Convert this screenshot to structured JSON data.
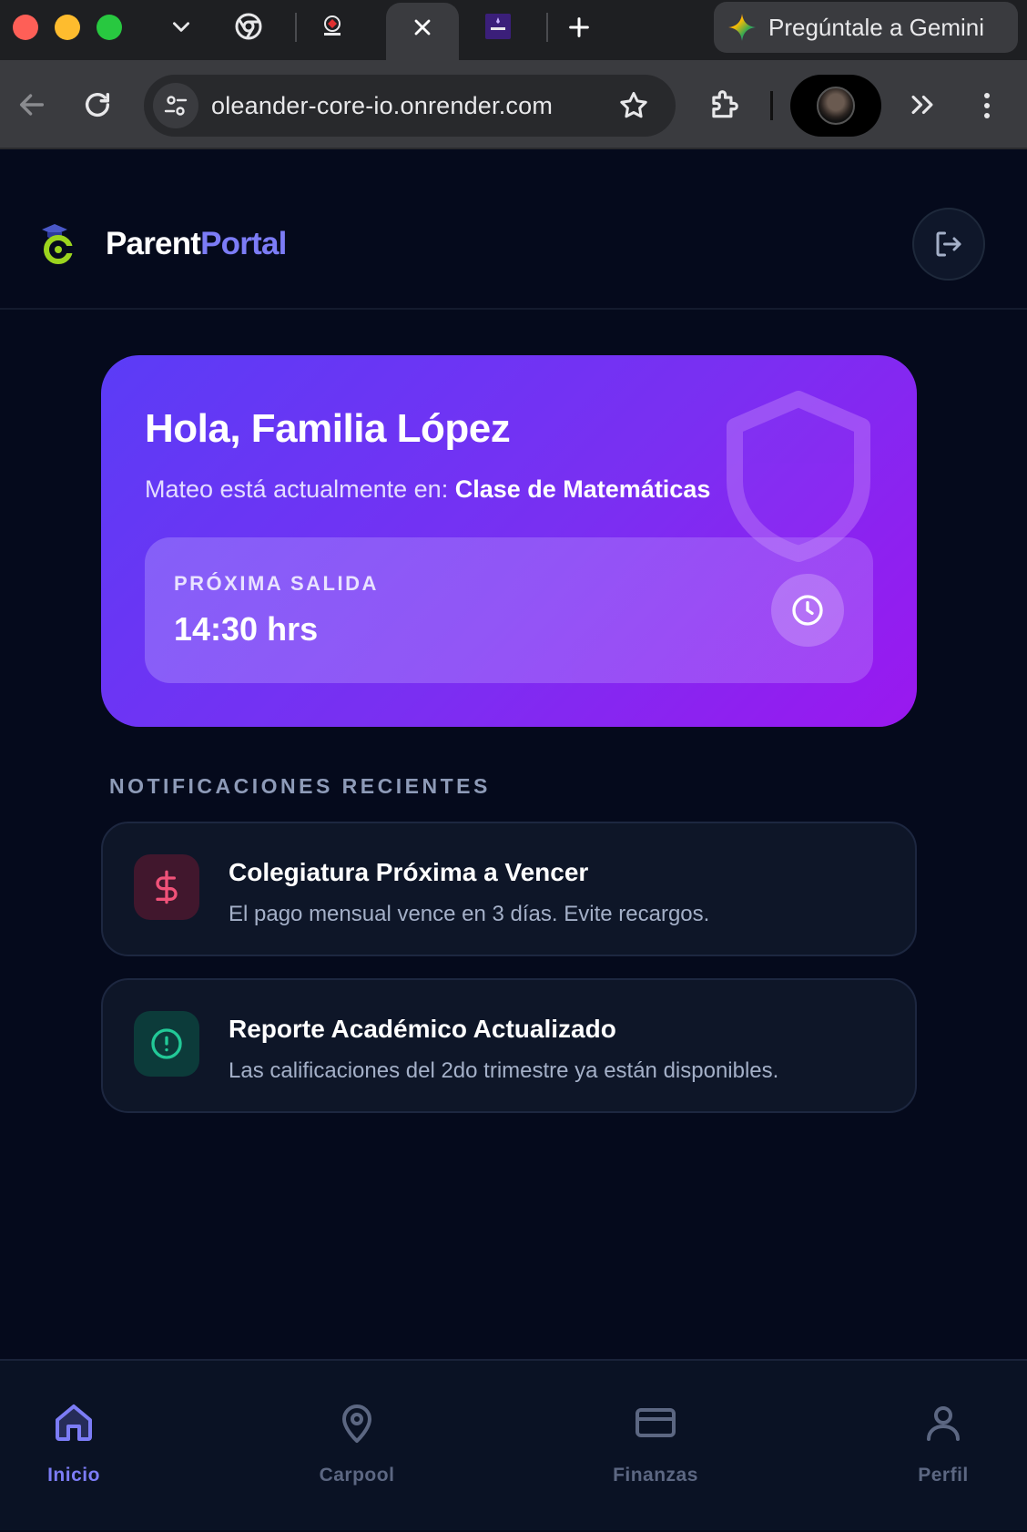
{
  "browser": {
    "gemini_label": "Pregúntale a Gemini",
    "url": "oleander-core-io.onrender.com"
  },
  "app": {
    "brand_part1": "Parent",
    "brand_part2": "Portal"
  },
  "hero": {
    "greeting": "Hola, Familia López",
    "status_prefix": "Mateo está actualmente en: ",
    "status_location": "Clase de Matemáticas",
    "exit_label": "PRÓXIMA SALIDA",
    "exit_time": "14:30 hrs"
  },
  "notifications": {
    "section_title": "NOTIFICACIONES RECIENTES",
    "items": [
      {
        "title": "Colegiatura Próxima a Vencer",
        "body": "El pago mensual vence en 3 días. Evite recargos.",
        "icon": "dollar-icon",
        "color": "#f05279"
      },
      {
        "title": "Reporte Académico Actualizado",
        "body": "Las calificaciones del 2do trimestre ya están disponibles.",
        "icon": "alert-circle-icon",
        "color": "#22c997"
      }
    ]
  },
  "bottom_nav": {
    "items": [
      {
        "label": "Inicio",
        "icon": "home-icon",
        "active": true
      },
      {
        "label": "Carpool",
        "icon": "map-pin-icon",
        "active": false
      },
      {
        "label": "Finanzas",
        "icon": "credit-card-icon",
        "active": false
      },
      {
        "label": "Perfil",
        "icon": "user-icon",
        "active": false
      }
    ]
  },
  "colors": {
    "accent": "#7c7cf6",
    "hero_gradient_start": "#5b3cf6",
    "hero_gradient_end": "#9a18ef",
    "background": "#050a1c"
  }
}
